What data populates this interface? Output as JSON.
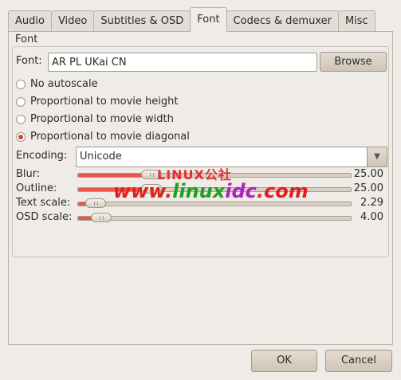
{
  "tabs": [
    {
      "label": "Audio",
      "active": false
    },
    {
      "label": "Video",
      "active": false
    },
    {
      "label": "Subtitles & OSD",
      "active": false
    },
    {
      "label": "Font",
      "active": true
    },
    {
      "label": "Codecs & demuxer",
      "active": false
    },
    {
      "label": "Misc",
      "active": false
    }
  ],
  "font_section": {
    "title": "Font",
    "font_label": "Font:",
    "font_value": "AR PL UKai CN",
    "browse_label": "Browse"
  },
  "autoscale": {
    "options": [
      {
        "label": "No autoscale",
        "checked": false
      },
      {
        "label": "Proportional to movie height",
        "checked": false
      },
      {
        "label": "Proportional to movie width",
        "checked": false
      },
      {
        "label": "Proportional to movie diagonal",
        "checked": true
      }
    ]
  },
  "encoding": {
    "label": "Encoding:",
    "value": "Unicode"
  },
  "sliders": [
    {
      "label": "Blur:",
      "value": "25.00",
      "fraction": 0.25
    },
    {
      "label": "Outline:",
      "value": "25.00",
      "fraction": 0.25
    },
    {
      "label": "Text scale:",
      "value": "2.29",
      "fraction": 0.03
    },
    {
      "label": "OSD scale:",
      "value": "4.00",
      "fraction": 0.05
    }
  ],
  "watermark": {
    "brand": "LINUX公社",
    "url_part1": "www.",
    "url_part2": "linux",
    "url_part3": "idc",
    "url_part4": ".com"
  },
  "buttons": {
    "ok_label": "OK",
    "cancel_label": "Cancel"
  },
  "colors": {
    "accent": "#e8554a",
    "radio_checked": "#d9442f"
  }
}
